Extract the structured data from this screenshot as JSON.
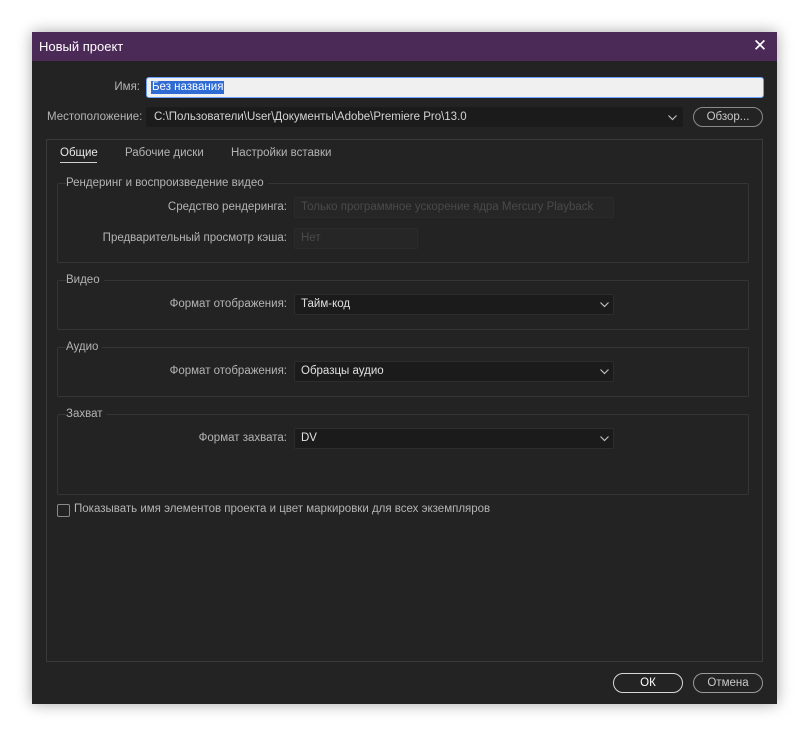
{
  "window": {
    "title": "Новый проект",
    "close_glyph": "✕"
  },
  "name_field": {
    "label": "Имя:",
    "value": "Без названия"
  },
  "location": {
    "label": "Местоположение:",
    "value": "C:\\Пользователи\\User\\Документы\\Adobe\\Premiere Pro\\13.0",
    "browse_label": "Обзор..."
  },
  "tabs": [
    {
      "label": "Общие",
      "active": true
    },
    {
      "label": "Рабочие диски",
      "active": false
    },
    {
      "label": "Настройки вставки",
      "active": false
    }
  ],
  "groups": {
    "render": {
      "title": "Рендеринг и воспроизведение видео",
      "renderer_label": "Средство рендеринга:",
      "renderer_value": "Только программное ускорение ядра Mercury Playback",
      "preview_cache_label": "Предварительный просмотр кэша:",
      "preview_cache_value": "Нет"
    },
    "video": {
      "title": "Видео",
      "format_label": "Формат отображения:",
      "format_value": "Тайм-код"
    },
    "audio": {
      "title": "Аудио",
      "format_label": "Формат отображения:",
      "format_value": "Образцы аудио"
    },
    "capture": {
      "title": "Захват",
      "format_label": "Формат захвата:",
      "format_value": "DV"
    }
  },
  "checkbox": {
    "label": "Показывать имя элементов проекта и цвет маркировки для всех экземпляров",
    "checked": false
  },
  "buttons": {
    "ok": "ОК",
    "cancel": "Отмена"
  },
  "colors": {
    "titlebar": "#4c2a57",
    "background": "#232323",
    "selection": "#2f6bd3"
  },
  "icons": [
    "close-icon",
    "chevron-down-icon",
    "checkbox-icon"
  ]
}
